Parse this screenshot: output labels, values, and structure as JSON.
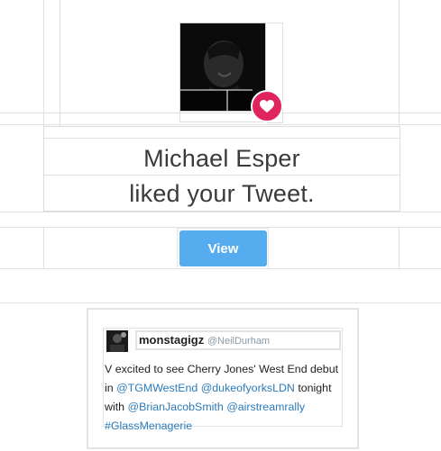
{
  "notification": {
    "headline_line1": "Michael Esper",
    "headline_line2": "liked your Tweet.",
    "view_label": "View"
  },
  "tweet": {
    "display_name": "monstagigz",
    "handle": "@NeilDurham",
    "text_part1": "V excited to see Cherry Jones' West End debut in ",
    "mention1": "@TGMWestEnd",
    "text_part2": " ",
    "mention2": "@dukeofyorksLDN",
    "text_part3": " tonight with ",
    "mention3": "@BrianJacobSmith",
    "text_part4": " ",
    "mention4": "@airstreamrally",
    "text_part5": " ",
    "hashtag1": "#GlassMenagerie"
  },
  "colors": {
    "accent_blue": "#55acee",
    "like_red": "#e0245e",
    "link_blue": "#2b7bb9"
  }
}
